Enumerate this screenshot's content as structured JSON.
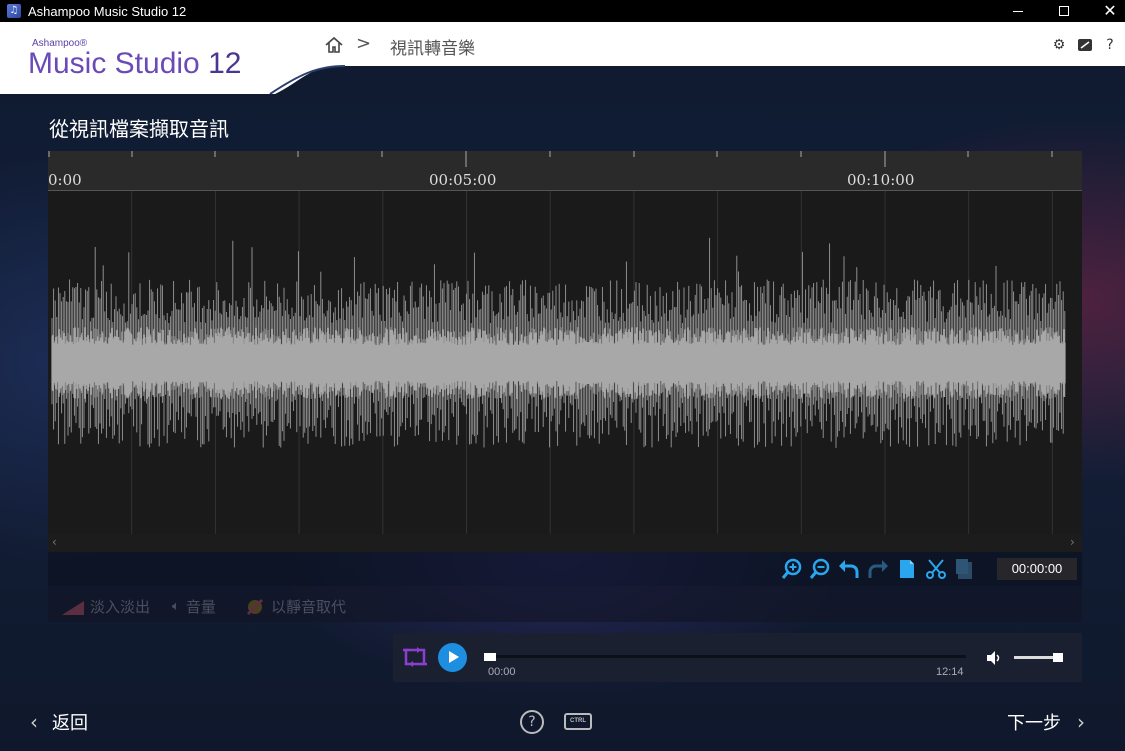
{
  "window": {
    "title": "Ashampoo Music Studio 12"
  },
  "brand": {
    "small": "Ashampoo®",
    "name": "Music Studio ",
    "version": "12"
  },
  "breadcrumb": {
    "separator": ">",
    "page": "視訊轉音樂"
  },
  "header_icons": [
    "gear-icon",
    "comment-icon",
    "help-icon"
  ],
  "page_title": "從視訊檔案擷取音訊",
  "ruler": {
    "labels": [
      "0:00",
      "00:05:00",
      "00:10:00"
    ]
  },
  "toolbar": {
    "icons": [
      "zoom-in-icon",
      "zoom-out-icon",
      "undo-icon",
      "redo-icon",
      "copy-icon",
      "cut-icon",
      "paste-icon"
    ],
    "time": "00:00:00"
  },
  "effects": {
    "fade": "淡入淡出",
    "volume": "音量",
    "silence": "以靜音取代"
  },
  "player": {
    "start": "00:00",
    "end": "12:14",
    "progress": 0
  },
  "footer": {
    "back": "返回",
    "next": "下一步",
    "help": "?",
    "ctrl": "CTRL"
  },
  "colors": {
    "accent": "#1e8fe0",
    "brand": "#6b4ab8",
    "loop": "#8a3fd0"
  }
}
